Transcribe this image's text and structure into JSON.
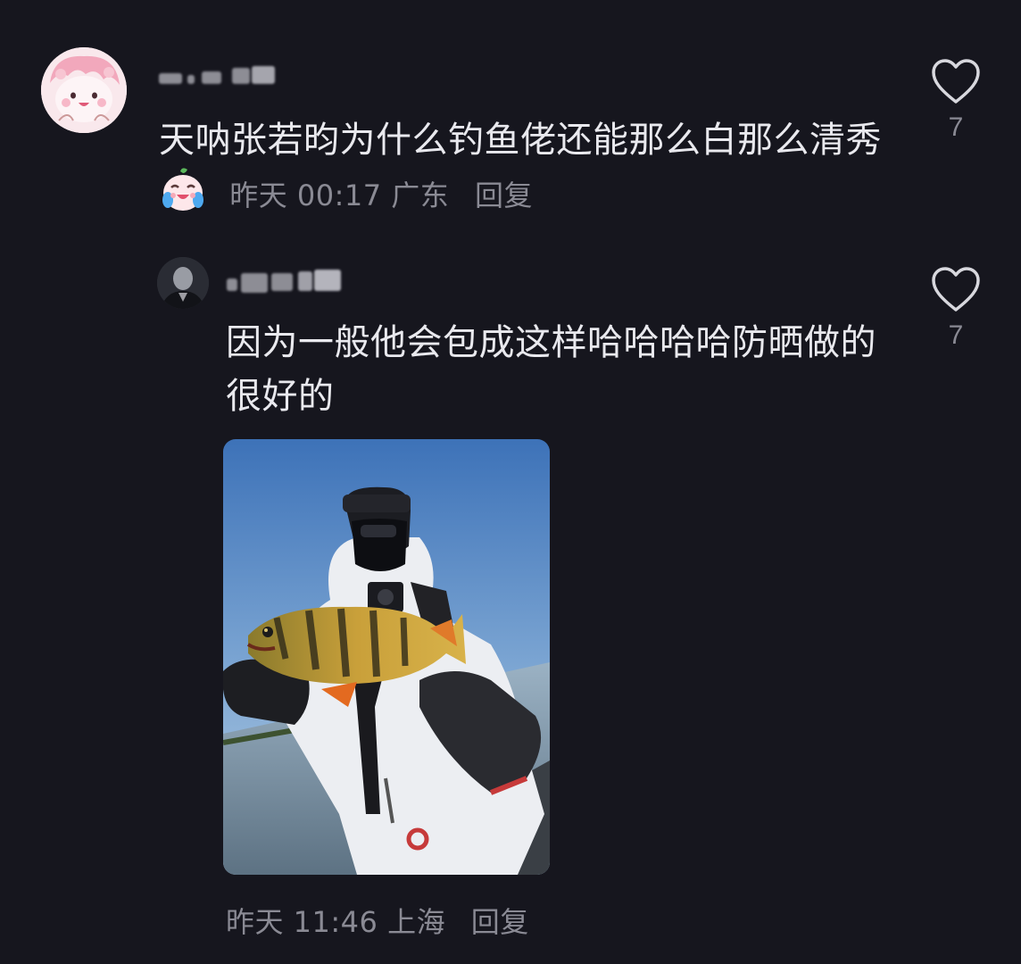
{
  "comment": {
    "text": "天呐张若昀为什么钓鱼佬还能那么白那么清秀",
    "emoji": "crying-laugh-emoji",
    "time": "昨天 00:17",
    "location": "广东",
    "reply_label": "回复",
    "like_count": "7"
  },
  "reply": {
    "text": "因为一般他会包成这样哈哈哈哈防晒做的很好的",
    "photo": "angler-holding-perch-photo",
    "time": "昨天 11:46",
    "location": "上海",
    "reply_label": "回复",
    "like_count": "7"
  },
  "colors": {
    "background": "#16161e",
    "text": "#e9e9ee",
    "meta": "#8a8a94"
  }
}
